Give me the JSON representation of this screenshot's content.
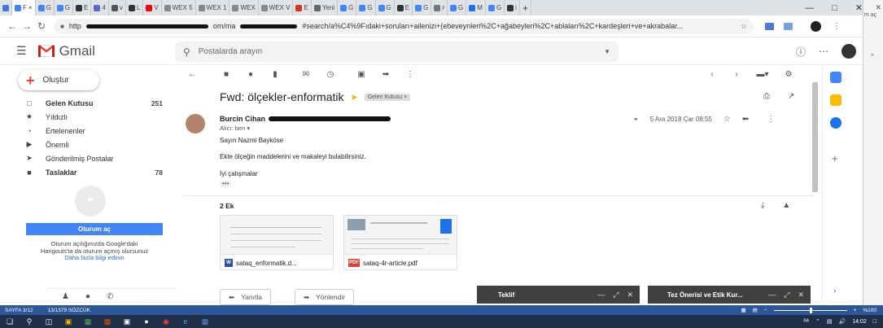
{
  "browser": {
    "tabs": [
      {
        "label": "F",
        "color": "#4285f4"
      },
      {
        "label": "G",
        "color": "#4285f4"
      },
      {
        "label": "G",
        "color": "#4285f4"
      },
      {
        "label": "E",
        "color": "#333333"
      },
      {
        "label": "4",
        "color": "#5c6bc0"
      },
      {
        "label": "v",
        "color": "#555555"
      },
      {
        "label": "L",
        "color": "#333333"
      },
      {
        "label": "V",
        "color": "#ff0000"
      },
      {
        "label": "WEX 5",
        "color": "#888888"
      },
      {
        "label": "WEX 1",
        "color": "#888888"
      },
      {
        "label": "WEX",
        "color": "#888888"
      },
      {
        "label": "WEX V",
        "color": "#888888"
      },
      {
        "label": "E",
        "color": "#d93025"
      },
      {
        "label": "Yeni",
        "color": "#666666"
      },
      {
        "label": "G",
        "color": "#4285f4"
      },
      {
        "label": "G",
        "color": "#4285f4"
      },
      {
        "label": "G",
        "color": "#4285f4"
      },
      {
        "label": "E",
        "color": "#333333"
      },
      {
        "label": "G",
        "color": "#4285f4"
      },
      {
        "label": "r",
        "color": "#777777"
      },
      {
        "label": "G",
        "color": "#4285f4"
      },
      {
        "label": "M",
        "color": "#1a73e8"
      },
      {
        "label": "G",
        "color": "#4285f4"
      },
      {
        "label": "i",
        "color": "#333333"
      }
    ],
    "new_tab": "+",
    "url_start": "http",
    "url_mid": "om/ma",
    "url_rest": "#search/a%C4%9Fıdaki+soruları+ailenizi+(ebeveynleri%2C+ağabeyleri%2C+ablaları%2C+kardeşleri+ve+akrabalar...",
    "edge_text": "m aç"
  },
  "gmail": {
    "brand": "Gmail",
    "search_placeholder": "Postalarda arayın",
    "compose_label": "Oluştur",
    "nav": [
      {
        "label": "Gelen Kutusu",
        "count": "251",
        "bold": true,
        "icon": "inbox-icon",
        "glyph": "□"
      },
      {
        "label": "Yıldızlı",
        "count": "",
        "bold": false,
        "icon": "star-icon",
        "glyph": "★"
      },
      {
        "label": "Ertelenenler",
        "count": "",
        "bold": false,
        "icon": "clock-icon",
        "glyph": "◔"
      },
      {
        "label": "Önemli",
        "count": "",
        "bold": false,
        "icon": "important-icon",
        "glyph": "▶"
      },
      {
        "label": "Gönderilmiş Postalar",
        "count": "",
        "bold": false,
        "icon": "send-icon",
        "glyph": "➤"
      },
      {
        "label": "Taslaklar",
        "count": "78",
        "bold": true,
        "icon": "draft-icon",
        "glyph": "■"
      }
    ],
    "hangouts": {
      "signin_button": "Oturum aç",
      "text_line1": "Oturum açılığınızda Google'daki",
      "text_line2": "Hangouts'ta da oturum açmış olursunuz",
      "link": "Daha fazla bilgi edinin"
    },
    "message": {
      "subject": "Fwd: ölçekler-enformatik",
      "label_chip": "Gelen Kutusu ×",
      "sender_name": "Burcin Cihan",
      "to_line": "Alıcı: ben ▾",
      "date": "5 Ara 2018 Çar 08:55",
      "body": [
        "Sayın  Nazmi Bayköse",
        "Ekte ölçeğin maddelerini ve makaleyi bulabilirsiniz.",
        "İyi çalışmalar"
      ],
      "ellipsis": "•••",
      "attachments_header": "2 Ek",
      "attachments": [
        {
          "name": "sataq_enformatik.d...",
          "badge": "W",
          "badge_color": "#2b579a"
        },
        {
          "name": "sataq-4r-article.pdf",
          "badge": "PDF",
          "badge_color": "#db4437"
        }
      ],
      "reply_label": "Yanıtla",
      "forward_label": "Yönlendir"
    },
    "chats": [
      {
        "title": "Teklif"
      },
      {
        "title": "Tez Önerisi ve Etik Kur..."
      }
    ]
  },
  "word_status": {
    "page": "SAYFA 3/12",
    "words": "13/1379 SÖZCÜK",
    "zoom": "%100"
  },
  "taskbar": {
    "time": "14:02",
    "lang": "ᴿᴬ"
  }
}
